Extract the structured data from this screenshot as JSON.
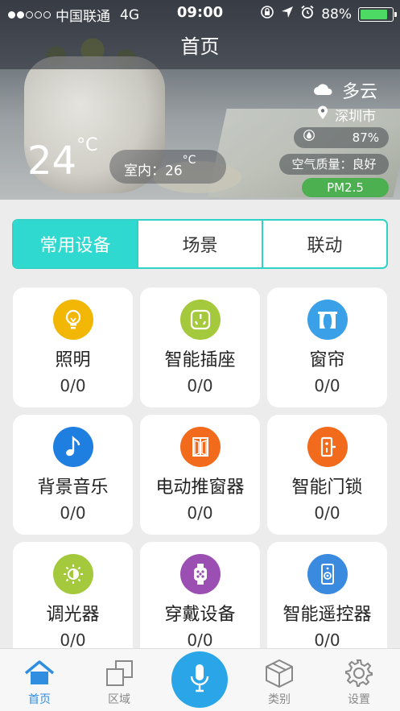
{
  "status_bar": {
    "carrier": "中国联通",
    "network": "4G",
    "time": "09:00",
    "battery": "88%",
    "battery_level": 0.88,
    "battery_color": "#4cd964"
  },
  "header": {
    "title": "首页"
  },
  "weather": {
    "condition": "多云",
    "city": "深圳市",
    "humidity": "87%",
    "air_quality": "空气质量：良好",
    "pm": "PM2.5",
    "outdoor_temp": "24",
    "outdoor_unit": "°C",
    "indoor_label": "室内：",
    "indoor_temp": "26",
    "indoor_unit": "°C"
  },
  "tabs": [
    {
      "label": "常用设备",
      "active": true
    },
    {
      "label": "场景",
      "active": false
    },
    {
      "label": "联动",
      "active": false
    }
  ],
  "accent_color": "#2fd9cf",
  "devices": [
    {
      "name": "照明",
      "count": "0/0",
      "icon": "bulb-icon",
      "color": "#f2b705"
    },
    {
      "name": "智能插座",
      "count": "0/0",
      "icon": "socket-icon",
      "color": "#a5c93c"
    },
    {
      "name": "窗帘",
      "count": "0/0",
      "icon": "curtain-icon",
      "color": "#3aa0e8"
    },
    {
      "name": "背景音乐",
      "count": "0/0",
      "icon": "music-note-icon",
      "color": "#1e7fe0"
    },
    {
      "name": "电动推窗器",
      "count": "0/0",
      "icon": "window-opener-icon",
      "color": "#f26a1b"
    },
    {
      "name": "智能门锁",
      "count": "0/0",
      "icon": "door-lock-icon",
      "color": "#f26a1b"
    },
    {
      "name": "调光器",
      "count": "0/0",
      "icon": "dimmer-icon",
      "color": "#a5c93c"
    },
    {
      "name": "穿戴设备",
      "count": "0/0",
      "icon": "smartwatch-icon",
      "color": "#9b4fb3"
    },
    {
      "name": "智能遥控器",
      "count": "0/0",
      "icon": "remote-control-icon",
      "color": "#3a8be0"
    }
  ],
  "tab_bar": {
    "items": [
      {
        "label": "首页",
        "icon": "home-icon",
        "active": true
      },
      {
        "label": "区域",
        "icon": "area-icon",
        "active": false
      },
      {
        "label": "",
        "icon": "microphone-icon",
        "active": false
      },
      {
        "label": "类别",
        "icon": "category-box-icon",
        "active": false
      },
      {
        "label": "设置",
        "icon": "gear-icon",
        "active": false
      }
    ],
    "active_color": "#2f8ee0",
    "mic_color": "#2aa6e8"
  }
}
